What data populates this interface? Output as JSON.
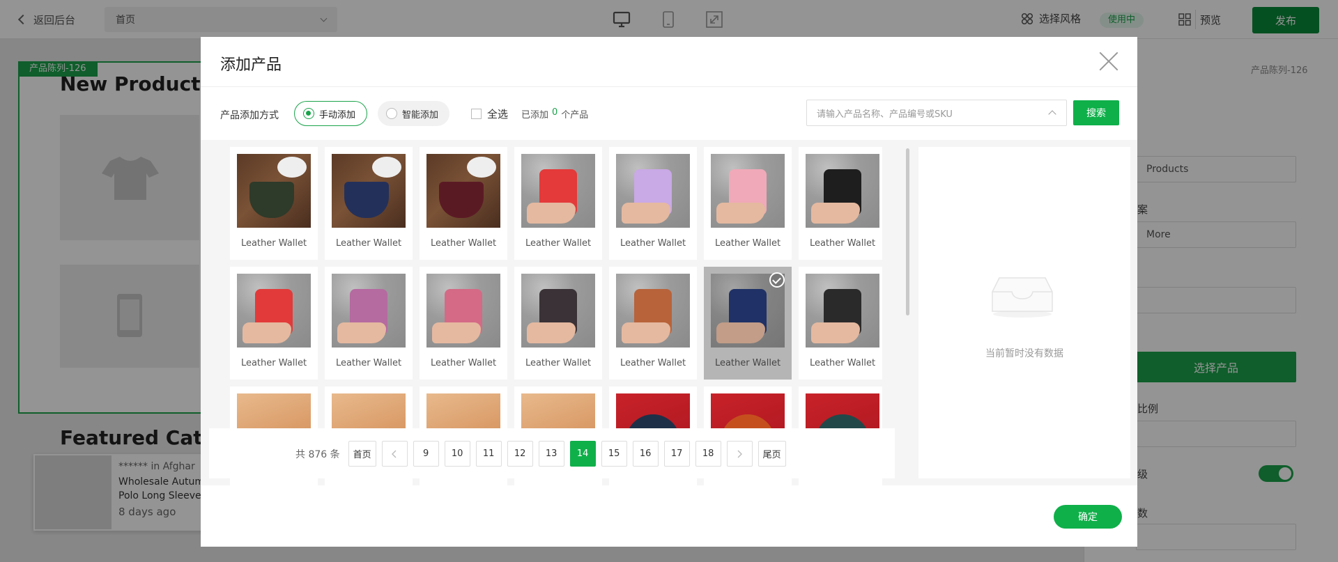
{
  "topbar": {
    "back_label": "返回后台",
    "page_select_value": "首页",
    "style_label": "选择风格",
    "in_use_badge": "使用中",
    "preview_label": "预览",
    "publish_label": "发布"
  },
  "editor": {
    "block_tag": "产品陈列-126",
    "new_products_title": "New Products",
    "featured_title": "Featured Cate",
    "notice": {
      "line1": "****** in Afghar",
      "line2": "Wholesale Autum",
      "line3": "Polo Long Sleeve S",
      "time": "8 days ago"
    }
  },
  "right_panel": {
    "tag": "产品陈列-126",
    "title_value": "Products",
    "label_copy": "案",
    "more_value": "More",
    "choose_button": "选择产品",
    "ratio_label": "比例",
    "level_label": "级",
    "count_label": "数"
  },
  "modal": {
    "title": "添加产品",
    "method_label": "产品添加方式",
    "manual_option": "手动添加",
    "smart_option": "智能添加",
    "select_all": "全选",
    "added_prefix": "已添加",
    "added_count": "0",
    "added_suffix": "个产品",
    "search_placeholder": "请输入产品名称、产品编号或SKU",
    "search_button": "搜索",
    "empty_text": "当前暂时没有数据",
    "confirm_button": "确定",
    "pagination": {
      "total": "共 876 条",
      "first": "首页",
      "last": "尾页",
      "pages": [
        "9",
        "10",
        "11",
        "12",
        "13",
        "14",
        "15",
        "16",
        "17",
        "18"
      ],
      "current": "14"
    },
    "products": [
      {
        "label": "Leather Wallet",
        "img": "photo",
        "color": "#2e3a2a",
        "selected": false
      },
      {
        "label": "Leather Wallet",
        "img": "photo",
        "color": "#23305a",
        "selected": false
      },
      {
        "label": "Leather Wallet",
        "img": "photo",
        "color": "#5a1a24",
        "selected": false
      },
      {
        "label": "Leather Wallet",
        "img": "tex",
        "color": "#e43a3a",
        "selected": false
      },
      {
        "label": "Leather Wallet",
        "img": "tex",
        "color": "#c9a9e6",
        "selected": false
      },
      {
        "label": "Leather Wallet",
        "img": "tex",
        "color": "#f0a9b8",
        "selected": false
      },
      {
        "label": "Leather Wallet",
        "img": "tex",
        "color": "#1e1e1e",
        "selected": false
      },
      {
        "label": "Leather Wallet",
        "img": "tex",
        "color": "#e23a3a",
        "selected": false
      },
      {
        "label": "Leather Wallet",
        "img": "tex",
        "color": "#b56aa0",
        "selected": false
      },
      {
        "label": "Leather Wallet",
        "img": "tex",
        "color": "#d46a86",
        "selected": false
      },
      {
        "label": "Leather Wallet",
        "img": "tex",
        "color": "#3a3236",
        "selected": false
      },
      {
        "label": "Leather Wallet",
        "img": "tex",
        "color": "#b8633a",
        "selected": false
      },
      {
        "label": "Leather Wallet",
        "img": "tex",
        "color": "#253a78",
        "selected": true
      },
      {
        "label": "Leather Wallet",
        "img": "tex",
        "color": "#2a2a2a",
        "selected": false
      },
      {
        "label": "",
        "img": "warm",
        "color": "#b8281e",
        "selected": false
      },
      {
        "label": "",
        "img": "warm",
        "color": "#d9a0a0",
        "selected": false
      },
      {
        "label": "",
        "img": "warm",
        "color": "#1f6a4e",
        "selected": false
      },
      {
        "label": "",
        "img": "warm",
        "color": "#2a2a2a",
        "selected": false
      },
      {
        "label": "",
        "img": "red",
        "color": "#1e3048",
        "selected": false
      },
      {
        "label": "",
        "img": "red",
        "color": "#c5501e",
        "selected": false
      },
      {
        "label": "",
        "img": "red",
        "color": "#22484a",
        "selected": false
      }
    ]
  }
}
